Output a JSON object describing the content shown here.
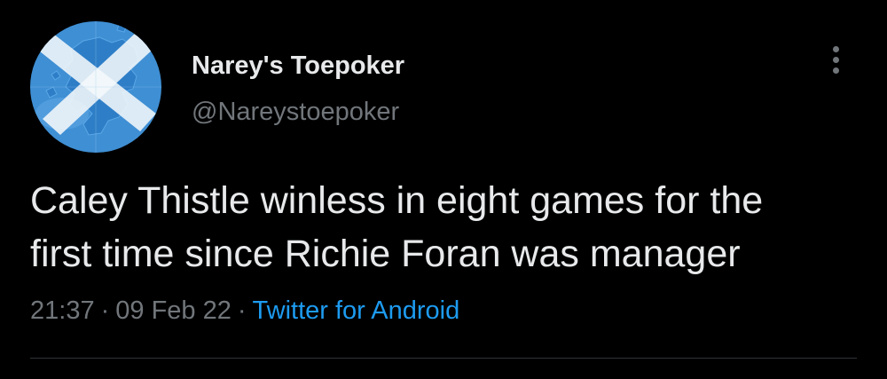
{
  "author": {
    "display_name": "Narey's Toepoker",
    "handle": "@Nareystoepoker",
    "avatar_icon": "scotland-saltire-map-avatar"
  },
  "tweet": {
    "text": "Caley Thistle winless in eight games for the\nfirst time since Richie Foran was manager",
    "time": "21:37",
    "separator": "·",
    "date": "09 Feb 22",
    "source": "Twitter for Android"
  },
  "menu": {
    "icon": "more-vertical-icon"
  },
  "colors": {
    "background": "#000000",
    "primary_text": "#e7e9ea",
    "secondary_text": "#71767b",
    "link": "#1d9bf0",
    "divider": "#2f3336"
  }
}
